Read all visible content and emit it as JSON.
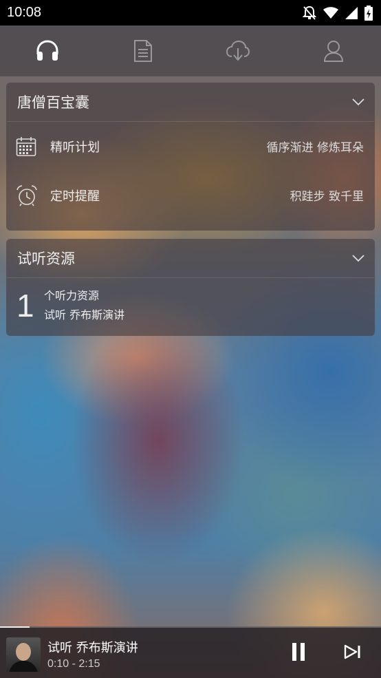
{
  "status_bar": {
    "time": "10:08"
  },
  "tabs": [
    {
      "icon": "headphones-icon",
      "active": true
    },
    {
      "icon": "document-icon",
      "active": false
    },
    {
      "icon": "cloud-download-icon",
      "active": false
    },
    {
      "icon": "user-icon",
      "active": false
    }
  ],
  "toolbox": {
    "title": "唐僧百宝囊",
    "items": [
      {
        "icon": "calendar-icon",
        "label": "精听计划",
        "value": "循序渐进 修炼耳朵"
      },
      {
        "icon": "alarm-clock-icon",
        "label": "定时提醒",
        "value": "积跬步 致千里"
      }
    ]
  },
  "resources": {
    "title": "试听资源",
    "count": "1",
    "count_label": "个听力资源",
    "item": "试听 乔布斯演讲"
  },
  "player": {
    "title": "试听 乔布斯演讲",
    "time": "0:10 - 2:15",
    "progress": 0.077
  },
  "colors": {
    "icon_active": "#ffffff",
    "icon_inactive": "#9a9a9a"
  }
}
